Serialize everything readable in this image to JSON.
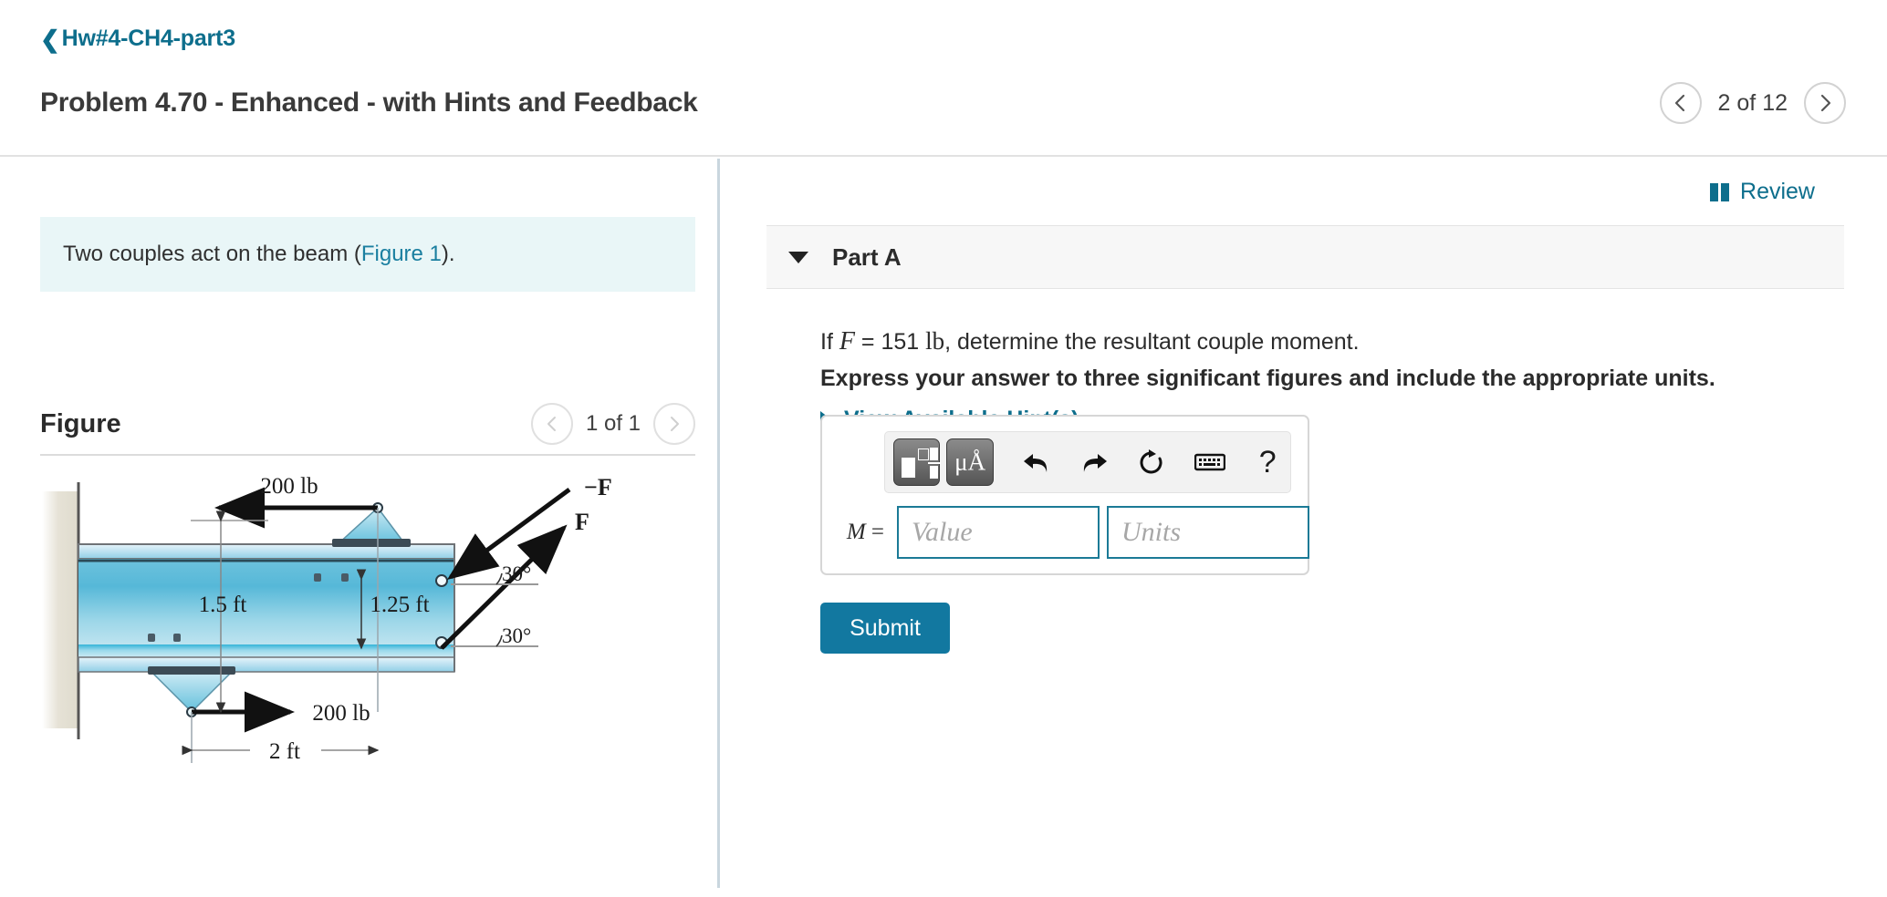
{
  "header": {
    "breadcrumb_label": "Hw#4-CH4-part3",
    "back_icon": "chevron-left-icon",
    "problem_title": "Problem 4.70 - Enhanced - with Hints and Feedback",
    "pager": {
      "prev_icon": "chevron-left-icon",
      "next_icon": "chevron-right-icon",
      "label": "2 of 12"
    }
  },
  "left_panel": {
    "statement_prefix": "Two couples act on the beam (",
    "statement_link": "Figure 1",
    "statement_suffix": ").",
    "figure_title": "Figure",
    "figure_pager": {
      "prev_icon": "chevron-left-icon",
      "next_icon": "chevron-right-icon",
      "label": "1 of 1"
    }
  },
  "figure": {
    "type": "free-body-diagram",
    "description": "Cantilever beam fixed at a wall with two couples applied",
    "labels": {
      "top_force": "200 lb",
      "bottom_force": "200 lb",
      "dim_vertical_left": "1.5 ft",
      "dim_vertical_right": "1.25 ft",
      "dim_horizontal": "2 ft",
      "angle_upper": "30°",
      "angle_lower": "30°",
      "force_negative": "−F",
      "force_positive": "F"
    }
  },
  "right_panel": {
    "review": {
      "icon": "book-icon",
      "label": "Review"
    },
    "part": {
      "toggle_icon": "caret-down-icon",
      "label": "Part A"
    },
    "question": {
      "prefix": "If ",
      "symbol": "F",
      "equals": " = 151 ",
      "unit": "lb",
      "suffix": ", determine the resultant couple moment."
    },
    "instruction": "Express your answer to three significant figures and include the appropriate units.",
    "hints": {
      "icon": "caret-right-icon",
      "label": "View Available Hint(s)"
    },
    "answer": {
      "toolbar": [
        {
          "name": "math-template-button",
          "icon": "template-icon",
          "label": ""
        },
        {
          "name": "units-button",
          "icon": "units-icon",
          "label": "μÅ"
        },
        {
          "name": "undo-button",
          "icon": "undo-icon",
          "label": ""
        },
        {
          "name": "redo-button",
          "icon": "redo-icon",
          "label": ""
        },
        {
          "name": "reset-button",
          "icon": "reset-icon",
          "label": ""
        },
        {
          "name": "keyboard-button",
          "icon": "keyboard-icon",
          "label": ""
        },
        {
          "name": "help-button",
          "icon": "question-mark-icon",
          "label": "?"
        }
      ],
      "m_label": "M",
      "m_equals": " =",
      "value_placeholder": "Value",
      "value_text": "",
      "units_placeholder": "Units",
      "units_text": ""
    },
    "submit_label": "Submit"
  },
  "colors": {
    "accent_teal": "#0d6e8c",
    "submit_blue": "#1278a0",
    "statement_bg": "#e9f6f7",
    "input_border": "#1b7a96"
  }
}
